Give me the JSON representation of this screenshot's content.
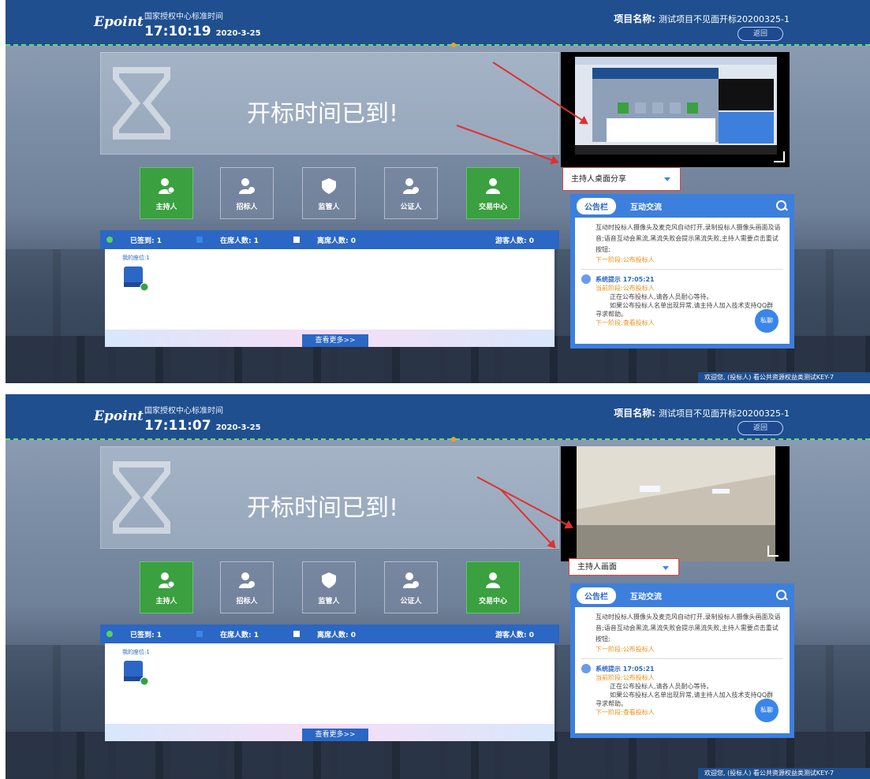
{
  "common": {
    "logo": "Epoint",
    "time_source": "国家授权中心标准时间",
    "project_label": "项目名称:",
    "project_name": "测试项目不见面开标20200325-1",
    "back_label": "返回",
    "board_text": "开标时间已到!",
    "roles": [
      "主持人",
      "招标人",
      "监管人",
      "公证人",
      "交易中心"
    ],
    "signed": "已签到: 1",
    "present": "在席人数: 1",
    "absent": "离席人数: 0",
    "visitors": "游客人数: 0",
    "my_seat": "我的座位:1",
    "more_label": "查看更多>>",
    "tab_notice": "公告栏",
    "tab_chat": "互动交流",
    "notice_text1": "互动时投标人摄像头及麦克风自动打开,录制投标人摄像头画面及语音;语音互动会黑流,黑流失败会提示黑流失败,主持人需要点击重试按钮;",
    "next_stage1": "下一阶段:公布投标人",
    "sys_title": "系统提示 17:05:21",
    "current_stage": "当前阶段:公布投标人",
    "notice_text2": "正在公布投标人,请各人员耐心等待。",
    "notice_text3": "如果公布投标人名单出现异常,请主持人加入技术支持QQ群",
    "notice_text4": "寻求帮助。",
    "next_stage2": "下一阶段:查看投标人",
    "chat_label": "私聊",
    "welcome": "欢迎您, (投标人) 看公共资源权益类测试KEY-7"
  },
  "panels": [
    {
      "clock": "17:10:19",
      "date": "2020-3-25",
      "select_value": "主持人桌面分享"
    },
    {
      "clock": "17:11:07",
      "date": "2020-3-25",
      "select_value": "主持人画面"
    }
  ]
}
